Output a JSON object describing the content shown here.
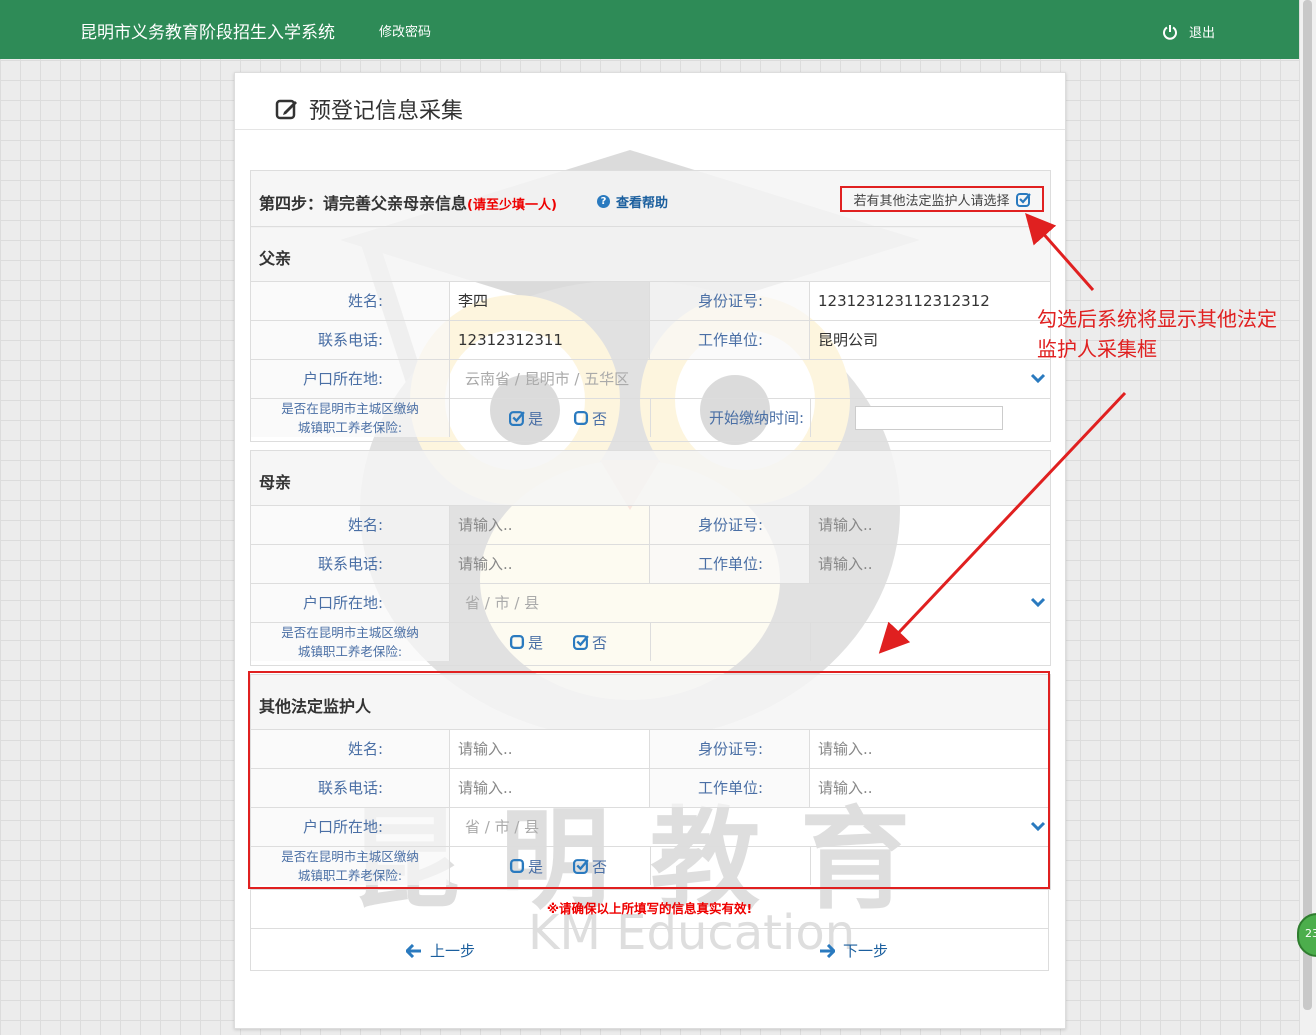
{
  "header": {
    "app_title": "昆明市义务教育阶段招生入学系统",
    "change_password": "修改密码",
    "logout": "退出"
  },
  "panel": {
    "title": "预登记信息采集"
  },
  "step": {
    "title": "第四步：请完善父亲母亲信息",
    "note": "(请至少填一人)",
    "help": "查看帮助",
    "other_guardian_checkbox": "若有其他法定监护人请选择"
  },
  "labels": {
    "name": "姓名:",
    "id_number": "身份证号:",
    "phone": "联系电话:",
    "work_unit": "工作单位:",
    "household": "户口所在地:",
    "insurance_line1": "是否在昆明市主城区缴纳",
    "insurance_line2": "城镇职工养老保险:",
    "pay_start": "开始缴纳时间:",
    "yes": "是",
    "no": "否"
  },
  "father": {
    "section": "父亲",
    "name": "李四",
    "id_number": "123123123112312312",
    "phone": "12312312311",
    "work_unit": "昆明公司",
    "address": "云南省 /  昆明市 /  五华区",
    "insurance": "是"
  },
  "mother": {
    "section": "母亲",
    "name_placeholder": "请输入..",
    "id_placeholder": "请输入..",
    "phone_placeholder": "请输入..",
    "work_placeholder": "请输入..",
    "address": "省 /  市 /  县",
    "insurance": "否"
  },
  "guardian": {
    "section": "其他法定监护人",
    "name_placeholder": "请输入..",
    "id_placeholder": "请输入..",
    "phone_placeholder": "请输入..",
    "work_placeholder": "请输入..",
    "address": "省 /  市 /  县",
    "insurance": "否"
  },
  "footer": {
    "notice": "※请确保以上所填写的信息真实有效!",
    "prev": "上一步",
    "next": "下一步"
  },
  "annotation": {
    "line1": "勾选后系统将显示其他法定",
    "line2": "监护人采集框"
  },
  "watermark": {
    "cn": "昆明教育",
    "en": "KM Education"
  },
  "badge": "23",
  "colors": {
    "header_green": "#2e8b57",
    "accent_red": "#e02020",
    "link_blue": "#1b5f9e",
    "label_blue": "#4a6fa5"
  }
}
